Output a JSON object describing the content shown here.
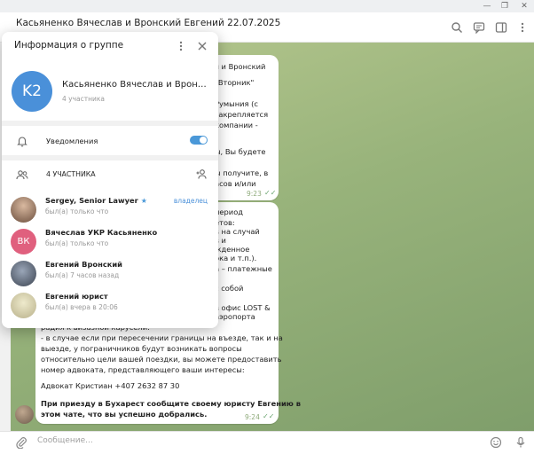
{
  "window": {
    "minimize": "—",
    "maximize": "❐",
    "close": "✕"
  },
  "chat": {
    "title": "Касьяненко Вячеслав и Вронский Евгений 22.07.2025",
    "input_placeholder": "Сообщение...",
    "message1": {
      "lines": [
        "ч и Вронский",
        "\"Вторник\"",
        "Румыния (с",
        "закрепляется",
        "компании -",
        "",
        "ы, Вы будете",
        "",
        "ы получите, в",
        "асов и/или"
      ],
      "time": "9:23"
    },
    "message2": {
      "lines": [
        "период",
        "етов:",
        "в на случай",
        "в и",
        "жденное",
        "ока и т.п.).",
        "а – платежные",
        "",
        "с собой",
        "",
        "в офис LOST &",
        "аэропорта",
        "радия к визазной карусели.",
        "- в случае если при пересечении границы на въезде, так и на",
        "выезде, у пограничников будут возникать вопросы",
        "относительно цели вашей поездки, вы можете предоставить",
        "номер адвоката, представляющего ваши интересы:",
        "",
        "Адвокат Кристиан +407 2632 87 30"
      ],
      "bold_lines": [
        "При приезду в Бухарест сообщите своему юристу Евгению в",
        "этом чате, что вы успешно добрались."
      ],
      "time": "9:24"
    }
  },
  "panel": {
    "title": "Информация о группе",
    "group": {
      "initials": "K2",
      "name": "Касьяненко Вячеслав и Вронский Евгений 22.07.2025",
      "members_count": "4 участника"
    },
    "notifications_label": "Уведомления",
    "notifications_on": true,
    "members_header": "4 УЧАСТНИКА",
    "members": [
      {
        "name": "Sergey, Senior Lawyer",
        "status": "был(а) только что",
        "role": "владелец",
        "star": "★",
        "initials": "",
        "color": "#6b4e3d"
      },
      {
        "name": "Вячеслав УКР Касьяненко",
        "status": "был(а) только что",
        "role": "",
        "star": "",
        "initials": "ВК",
        "color": "#e0607e"
      },
      {
        "name": "Евгений Вронский",
        "status": "был(а) 7 часов назад",
        "role": "",
        "star": "",
        "initials": "",
        "color": "#55606e"
      },
      {
        "name": "Евгений юрист",
        "status": "был(а) вчера в 20:06",
        "role": "",
        "star": "",
        "initials": "",
        "color": "#c8c2a0"
      }
    ]
  },
  "icons": {
    "notification": "bell-icon",
    "members": "users-icon",
    "add_member": "add-user-icon",
    "more": "more-vertical-icon",
    "close": "close-icon",
    "search": "search-icon",
    "comments": "comments-icon",
    "sidebar": "sidebar-icon",
    "attach": "paperclip-icon",
    "emoji": "emoji-icon",
    "mic": "microphone-icon",
    "verified": "star-icon"
  },
  "colors": {
    "accent": "#4a90d9",
    "group_avatar": "#4a90d9",
    "chat_bg": "#98b37b"
  }
}
